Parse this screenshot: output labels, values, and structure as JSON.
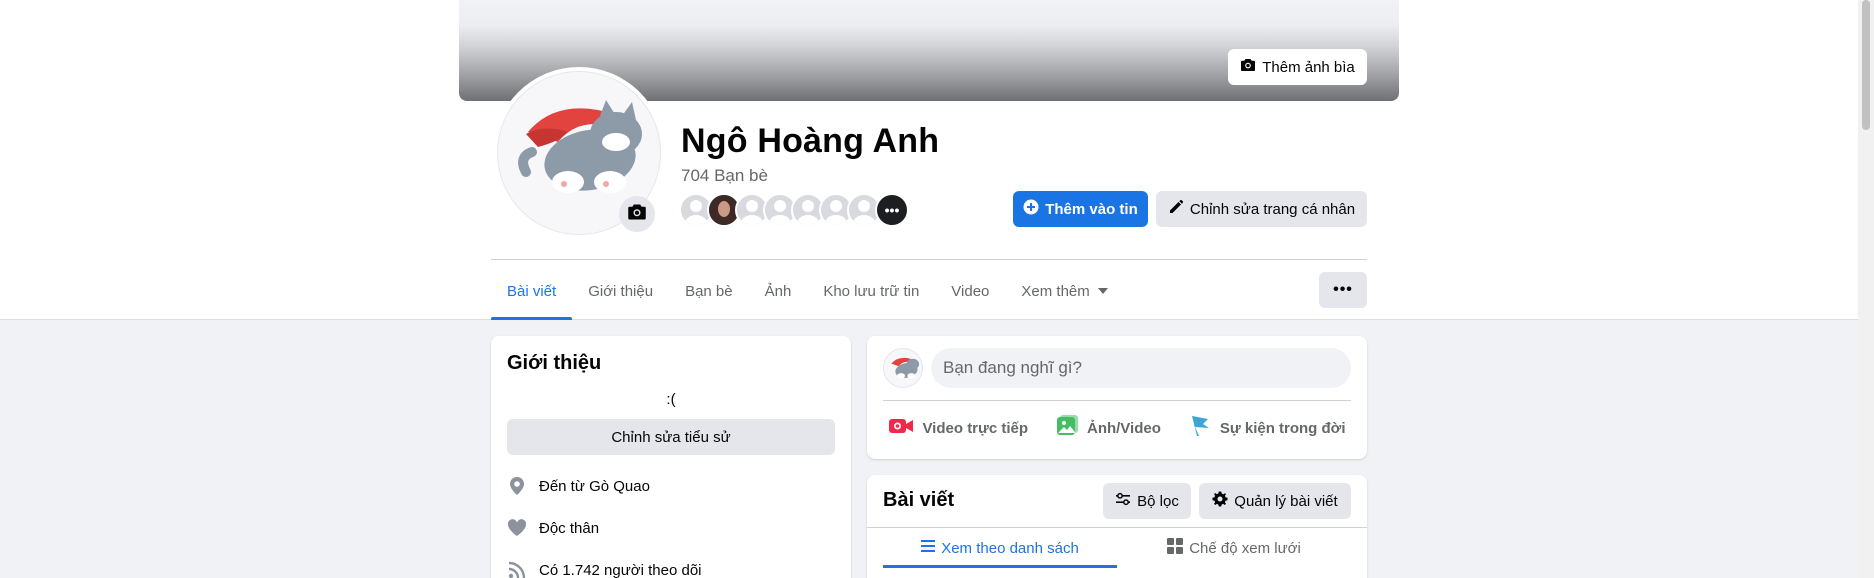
{
  "cover": {
    "add_cover_label": "Thêm ảnh bìa"
  },
  "profile": {
    "name": "Ngô Hoàng Anh",
    "friends_count": "704 Bạn bè",
    "more_friends_glyph": "•••",
    "add_story_label": "Thêm vào tin",
    "edit_profile_label": "Chỉnh sửa trang cá nhân"
  },
  "tabs": [
    {
      "label": "Bài viết",
      "active": true
    },
    {
      "label": "Giới thiệu"
    },
    {
      "label": "Bạn bè"
    },
    {
      "label": "Ảnh"
    },
    {
      "label": "Kho lưu trữ tin"
    },
    {
      "label": "Video"
    },
    {
      "label": "Xem thêm"
    }
  ],
  "more_options_glyph": "•••",
  "intro": {
    "title": "Giới thiệu",
    "bio": ":(",
    "edit_bio_label": "Chỉnh sửa tiểu sử",
    "from_prefix": "Đến từ ",
    "from_place": "Gò Quao",
    "relationship": "Độc thân",
    "followers_prefix": "Có ",
    "followers_count": "1.742 người",
    "followers_suffix": " theo dõi"
  },
  "composer": {
    "placeholder": "Bạn đang nghĩ gì?",
    "actions": [
      {
        "label": "Video trực tiếp",
        "icon": "live-video-icon",
        "color": "#f02849"
      },
      {
        "label": "Ảnh/Video",
        "icon": "photo-video-icon",
        "color": "#45bd62"
      },
      {
        "label": "Sự kiện trong đời",
        "icon": "life-event-flag-icon",
        "color": "#3ea6d4"
      }
    ]
  },
  "posts": {
    "title": "Bài viết",
    "filter_label": "Bộ lọc",
    "manage_label": "Quản lý bài viết",
    "list_view_label": "Xem theo danh sách",
    "grid_view_label": "Chế độ xem lưới"
  },
  "colors": {
    "accent": "#1b74e4",
    "background": "#f0f2f5",
    "secondary_text": "#65676b"
  }
}
